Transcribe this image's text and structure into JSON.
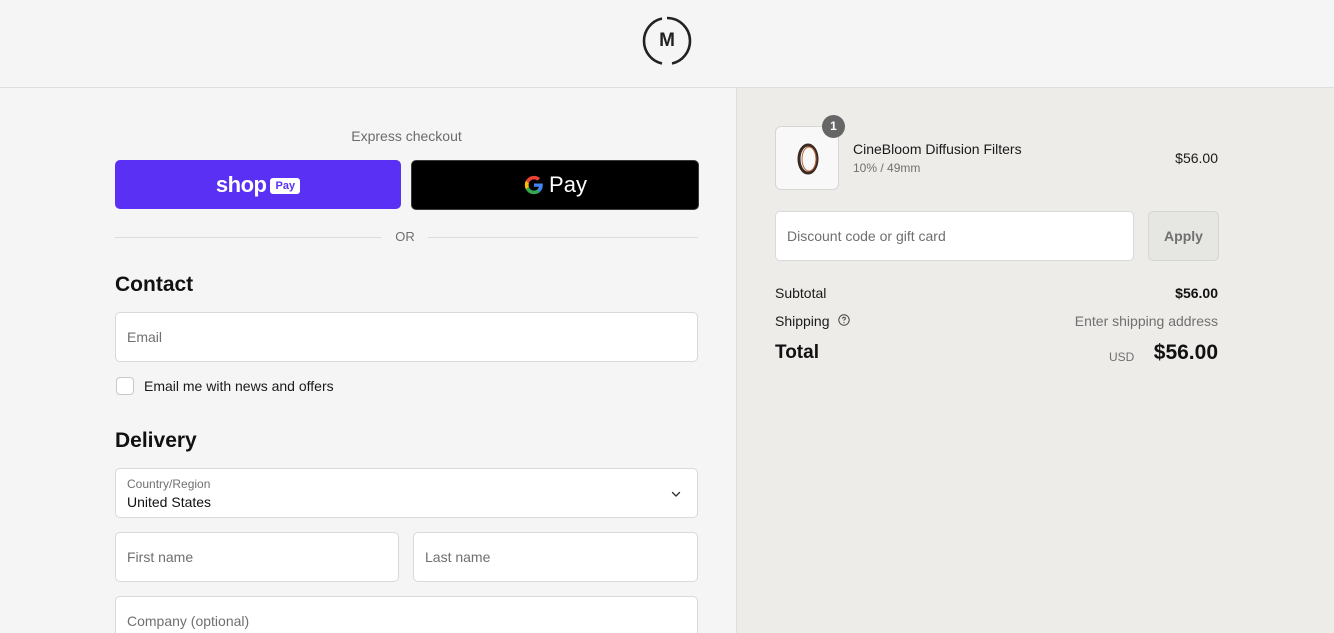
{
  "header": {
    "logo_letter": "M"
  },
  "express": {
    "label": "Express checkout",
    "shop_pay": {
      "word": "shop",
      "badge": "Pay"
    },
    "gpay": {
      "word": "Pay"
    },
    "or": "OR"
  },
  "contact": {
    "title": "Contact",
    "email_placeholder": "Email",
    "newsletter_label": "Email me with news and offers",
    "newsletter_checked": false
  },
  "delivery": {
    "title": "Delivery",
    "country_caption": "Country/Region",
    "country_value": "United States",
    "first_name_placeholder": "First name",
    "last_name_placeholder": "Last name",
    "company_placeholder": "Company (optional)"
  },
  "summary": {
    "item": {
      "quantity": "1",
      "name": "CineBloom Diffusion Filters",
      "variant": "10% / 49mm",
      "price": "$56.00"
    },
    "discount_placeholder": "Discount code or gift card",
    "apply_label": "Apply",
    "subtotal_label": "Subtotal",
    "subtotal_value": "$56.00",
    "shipping_label": "Shipping",
    "shipping_value": "Enter shipping address",
    "total_label": "Total",
    "total_currency": "USD",
    "total_value": "$56.00"
  },
  "colors": {
    "shop_pay": "#5a31f4",
    "gpay": "#000000",
    "summary_bg": "#edece9",
    "page_bg": "#f5f5f5"
  },
  "icons": [
    "logo-circle",
    "google-g-icon",
    "chevron-down-icon",
    "help-circle-icon",
    "filter-ring-thumbnail"
  ]
}
